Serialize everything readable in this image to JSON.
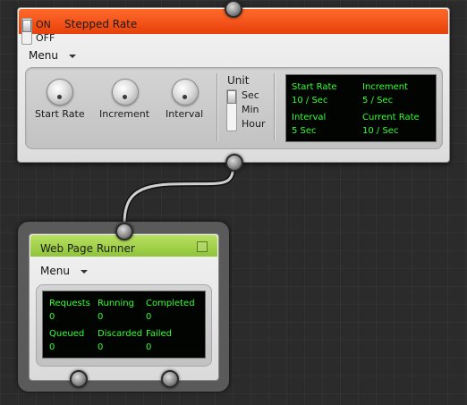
{
  "stepped_rate": {
    "title": "Stepped Rate",
    "toggle": {
      "on_label": "ON",
      "off_label": "OFF"
    },
    "menu_label": "Menu",
    "knobs": [
      {
        "label": "Start Rate"
      },
      {
        "label": "Increment"
      },
      {
        "label": "Interval"
      }
    ],
    "unit": {
      "title": "Unit",
      "options": [
        "Sec",
        "Min",
        "Hour"
      ],
      "selected": "Sec"
    },
    "display": {
      "start_rate_label": "Start Rate",
      "start_rate_value": "10 / Sec",
      "increment_label": "Increment",
      "increment_value": "5 / Sec",
      "interval_label": "Interval",
      "interval_value": "5 Sec",
      "current_rate_label": "Current Rate",
      "current_rate_value": "10 / Sec"
    },
    "header_color": "#e8400a"
  },
  "web_page_runner": {
    "title": "Web Page Runner",
    "menu_label": "Menu",
    "stats": {
      "requests_label": "Requests",
      "requests_value": "0",
      "running_label": "Running",
      "running_value": "0",
      "completed_label": "Completed",
      "completed_value": "0",
      "queued_label": "Queued",
      "queued_value": "0",
      "discarded_label": "Discarded",
      "discarded_value": "0",
      "failed_label": "Failed",
      "failed_value": "0"
    },
    "header_color": "#8fc43a"
  },
  "display_text_color": "#33ff33"
}
